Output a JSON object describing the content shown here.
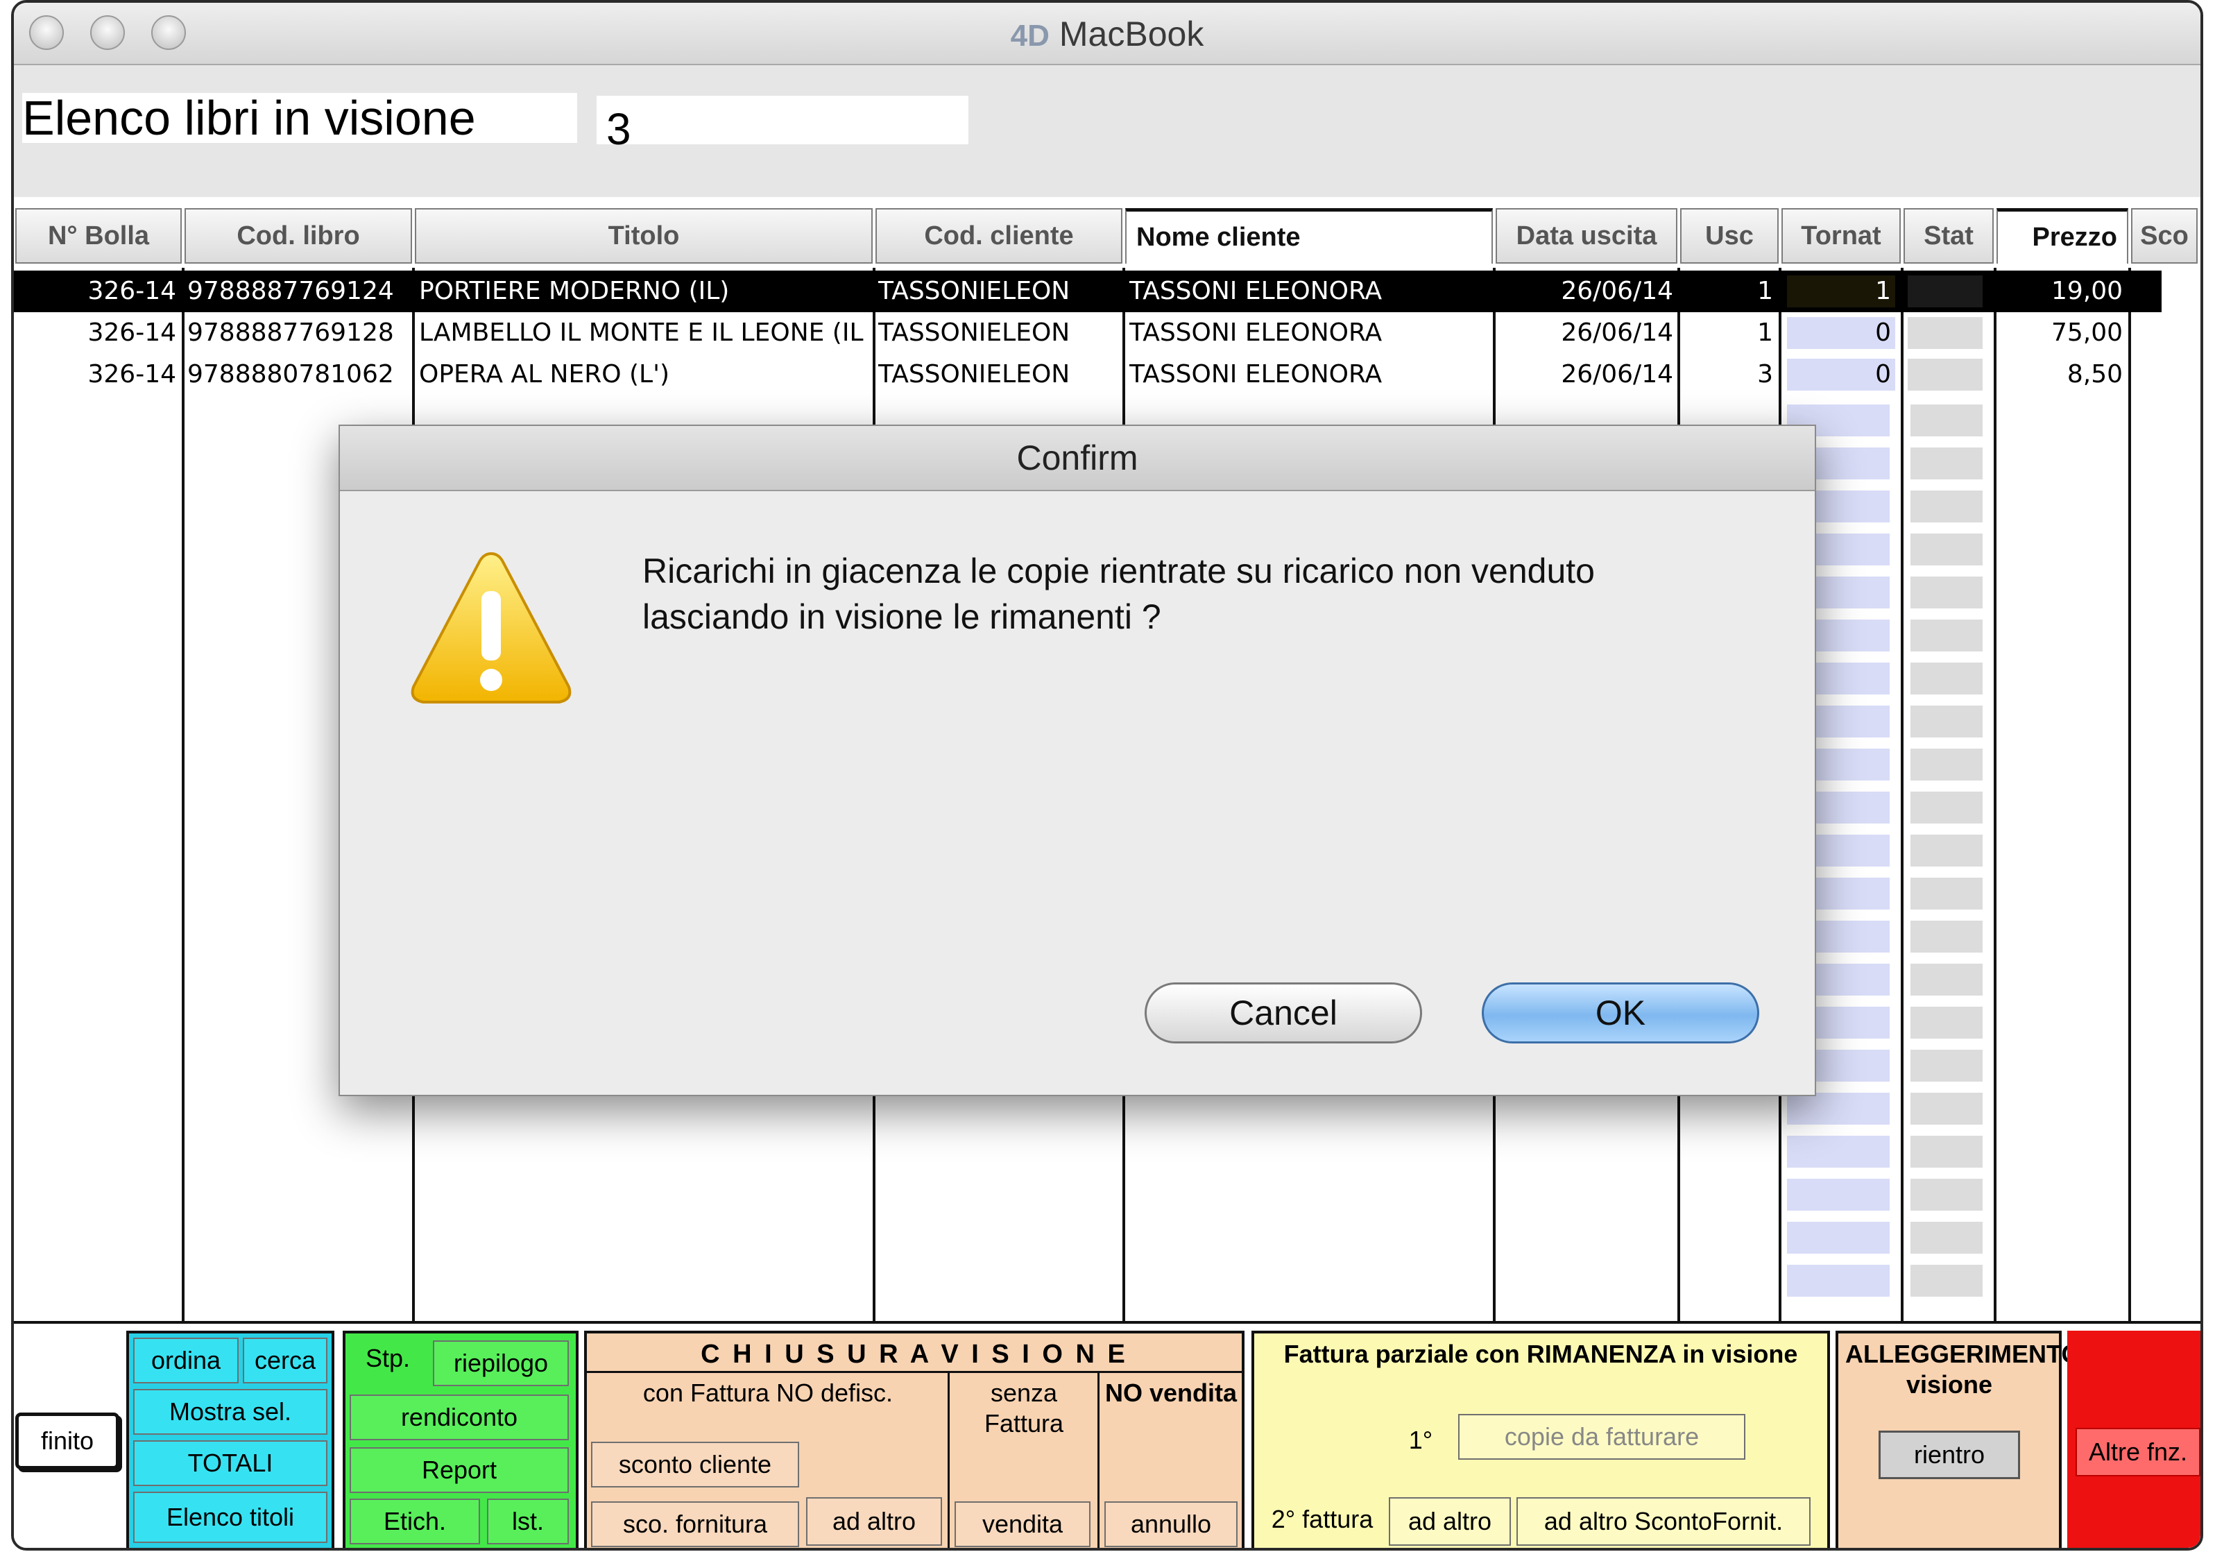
{
  "window": {
    "app_logo": "4D",
    "title": "MacBook"
  },
  "header": {
    "title": "Elenco libri in visione",
    "count": "3"
  },
  "columns": [
    "N° Bolla",
    "Cod. libro",
    "Titolo",
    "Cod. cliente",
    "Nome cliente",
    "Data uscita",
    "Usc",
    "Tornat",
    "Stat",
    "Prezzo",
    "Sco"
  ],
  "rows": [
    {
      "bolla": "326-14",
      "cod_libro": "9788887769124",
      "titolo": "PORTIERE MODERNO (IL)",
      "cod_cliente": "TASSONIELEON",
      "nome": "TASSONI ELEONORA",
      "data": "26/06/14",
      "usc": "1",
      "tornat": "1",
      "prezzo": "19,00"
    },
    {
      "bolla": "326-14",
      "cod_libro": "9788887769128",
      "titolo": "LAMBELLO IL MONTE E IL LEONE (IL",
      "cod_cliente": "TASSONIELEON",
      "nome": "TASSONI ELEONORA",
      "data": "26/06/14",
      "usc": "1",
      "tornat": "0",
      "prezzo": "75,00"
    },
    {
      "bolla": "326-14",
      "cod_libro": "9788880781062",
      "titolo": "OPERA AL NERO (L')",
      "cod_cliente": "TASSONIELEON",
      "nome": "TASSONI ELEONORA",
      "data": "26/06/14",
      "usc": "3",
      "tornat": "0",
      "prezzo": "8,50"
    }
  ],
  "bottom": {
    "finito": "finito",
    "cyan": {
      "ordina": "ordina",
      "cerca": "cerca",
      "mostra": "Mostra sel.",
      "totali": "TOTALI",
      "elenco": "Elenco titoli"
    },
    "green": {
      "stp": "Stp.",
      "riepilogo": "riepilogo",
      "rendiconto": "rendiconto",
      "report": "Report",
      "etich": "Etich.",
      "lst": "lst."
    },
    "chiusura": {
      "title": "C H I U S U R A   V I S I O N E",
      "con_fattura": "con Fattura NO defisc.",
      "senza_fattura": "senza Fattura",
      "no_vendita": "NO vendita",
      "sconto_cliente": "sconto cliente",
      "sco_fornitura": "sco. fornitura",
      "ad_altro": "ad altro",
      "vendita": "vendita",
      "annullo": "annullo"
    },
    "fattura": {
      "title": "Fattura parziale con RIMANENZA in visione",
      "first": "1°",
      "copie_placeholder": "copie da fatturare",
      "second": "2° fattura",
      "ad_altro": "ad altro",
      "ad_altro_sconto": "ad altro ScontoFornit."
    },
    "alleggerimento": {
      "title": "ALLEGGERIMENTO visione",
      "rientro": "rientro"
    },
    "altre": "Altre fnz."
  },
  "dialog": {
    "title": "Confirm",
    "message_line1": "Ricarichi in giacenza le copie rientrate su ricarico non venduto",
    "message_line2": "lasciando in visione le rimanenti ?",
    "cancel": "Cancel",
    "ok": "OK"
  },
  "colors": {
    "cyan": "#36e2f2",
    "green": "#58ef5b",
    "peach": "#f8d9bd",
    "yellow": "#fdfbc3",
    "red": "#ee1111",
    "ok_blue": "#7fb8ef"
  }
}
